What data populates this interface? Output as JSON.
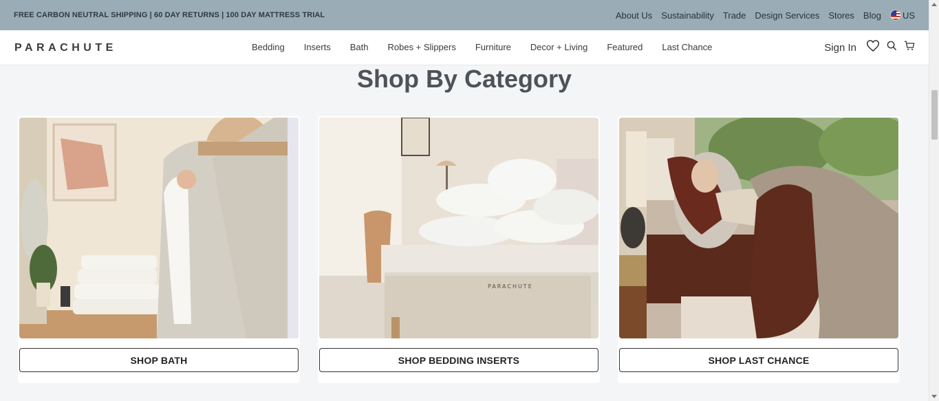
{
  "announcement": {
    "promo": "FREE CARBON NEUTRAL SHIPPING | 60 DAY RETURNS | 100 DAY MATTRESS TRIAL",
    "links": [
      "About Us",
      "Sustainability",
      "Trade",
      "Design Services",
      "Stores",
      "Blog"
    ],
    "region": "US",
    "region_icon": "us-flag-icon"
  },
  "header": {
    "logo": "PARACHUTE",
    "nav": [
      "Bedding",
      "Inserts",
      "Bath",
      "Robes + Slippers",
      "Furniture",
      "Decor + Living",
      "Featured",
      "Last Chance"
    ],
    "sign_in": "Sign In",
    "icons": [
      "heart-icon",
      "search-icon",
      "cart-icon"
    ]
  },
  "main": {
    "title": "Shop By Category",
    "cards": [
      {
        "button": "SHOP BATH",
        "image": "waffle-robe-photo"
      },
      {
        "button": "SHOP BEDDING INSERTS",
        "image": "pillows-mattress-photo"
      },
      {
        "button": "SHOP LAST CHANCE",
        "image": "woman-sleeping-photo"
      }
    ]
  },
  "colors": {
    "announcement_bg": "#9aacb6",
    "page_bg": "#f4f5f7",
    "title": "#4e5358"
  }
}
